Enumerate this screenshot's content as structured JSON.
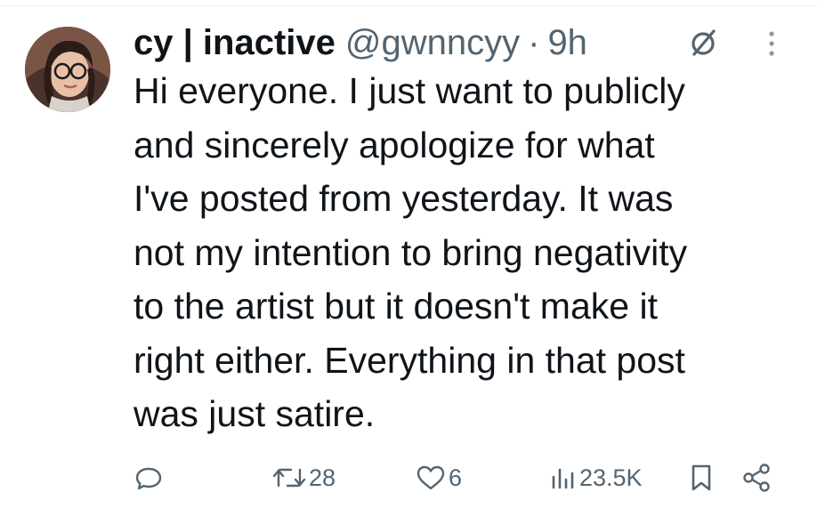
{
  "tweet": {
    "author": {
      "display_name": "cy | inactive",
      "handle": "@gwnncyy",
      "avatar_icon": "profile-photo"
    },
    "separator": "·",
    "time_ago": "9h",
    "text_lines": [
      "Hi everyone. I just want to publicly",
      "and sincerely apologize for what",
      "I've posted from yesterday. It was",
      "not my intention to bring negativity",
      "to the artist but it doesn't make it",
      "right either. Everything in that post",
      "was just satire."
    ],
    "actions": {
      "reply": {
        "icon": "reply-icon",
        "count": ""
      },
      "retweet": {
        "icon": "retweet-icon",
        "count": "28"
      },
      "like": {
        "icon": "heart-icon",
        "count": "6"
      },
      "views": {
        "icon": "views-icon",
        "count": "23.5K"
      },
      "bookmark": {
        "icon": "bookmark-icon"
      },
      "share": {
        "icon": "share-icon"
      }
    }
  },
  "colors": {
    "text": "#0f1419",
    "secondary": "#536471",
    "divider": "#eff3f4",
    "background": "#ffffff"
  }
}
